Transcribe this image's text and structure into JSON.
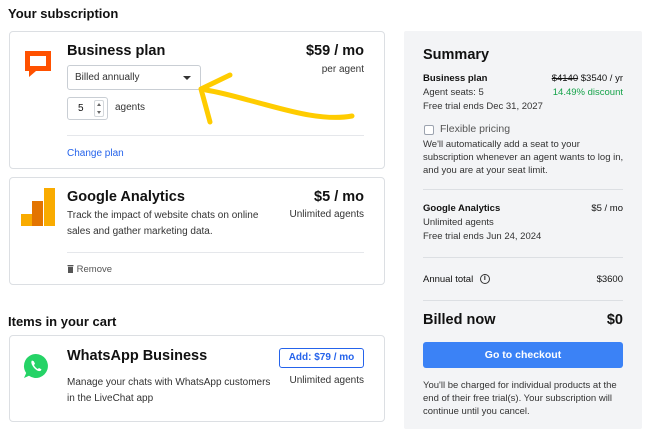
{
  "headings": {
    "subscription": "Your subscription",
    "cart": "Items in your cart"
  },
  "business_plan": {
    "icon": "chat-bubble-logo-icon",
    "title": "Business plan",
    "price": "$59 / mo",
    "price_sub": "per agent",
    "billing_select": "Billed annually",
    "agents_value": "5",
    "agents_label": "agents",
    "change_link": "Change plan"
  },
  "google_analytics": {
    "icon": "google-analytics-icon",
    "title": "Google Analytics",
    "price": "$5 / mo",
    "price_sub": "Unlimited agents",
    "description": "Track the impact of website chats on online sales and gather marketing data.",
    "remove": "Remove"
  },
  "whatsapp": {
    "icon": "whatsapp-icon",
    "title": "WhatsApp Business",
    "add_button": "Add: $79 / mo",
    "price_sub": "Unlimited agents",
    "description": "Manage your chats with WhatsApp customers in the LiveChat app"
  },
  "summary": {
    "title": "Summary",
    "plan_name": "Business plan",
    "old_price": "$4140",
    "new_price": "$3540 / yr",
    "agent_seats": "Agent seats: 5",
    "discount": "14.49% discount",
    "trial": "Free trial ends Dec 31, 2027",
    "flexible_label": "Flexible pricing",
    "flexible_desc": "We'll automatically add a seat to your subscription whenever an agent wants to log in, and you are at your seat limit.",
    "ga_name": "Google Analytics",
    "ga_price": "$5 / mo",
    "ga_agents": "Unlimited agents",
    "ga_trial": "Free trial ends Jun 24, 2024",
    "annual_label": "Annual total",
    "annual_value": "$3600",
    "billed_label": "Billed now",
    "billed_value": "$0",
    "checkout": "Go to checkout",
    "footer": "You'll be charged for individual products at the end of their free trial(s). Your subscription will continue until you cancel."
  },
  "colors": {
    "accent": "#3b82f6",
    "link": "#2563eb",
    "discount": "#16a34a",
    "livechat": "#ff5100",
    "analytics_orange": "#f9ab00",
    "analytics_dark": "#e37400",
    "whatsapp": "#25d366",
    "annotation_arrow": "#ffcc00"
  }
}
